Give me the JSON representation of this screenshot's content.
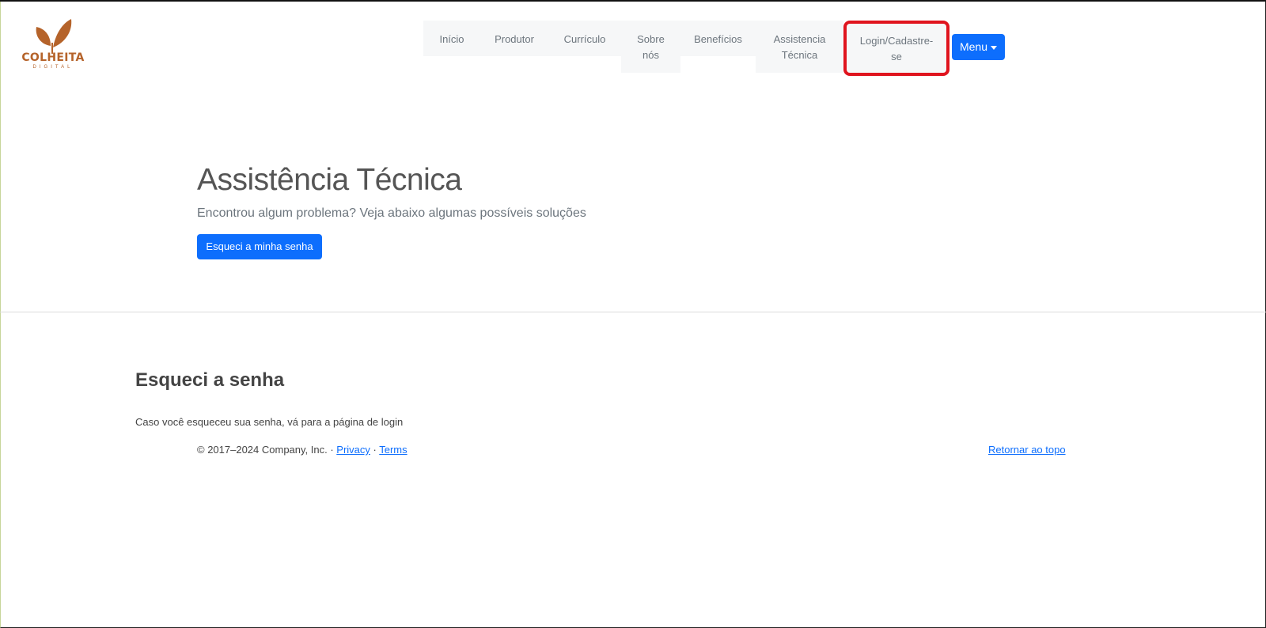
{
  "logo": {
    "word": "COLHEITA",
    "sub": "DIGITAL",
    "leaf_color": "#b5632a"
  },
  "nav": {
    "items": [
      {
        "line1": "Início",
        "line2": ""
      },
      {
        "line1": "Produtor",
        "line2": ""
      },
      {
        "line1": "Currículo",
        "line2": ""
      },
      {
        "line1": "Sobre",
        "line2": "nós"
      },
      {
        "line1": "Benefícios",
        "line2": ""
      },
      {
        "line1": "Assistencia",
        "line2": "Técnica"
      },
      {
        "line1": "Login/Cadastre-",
        "line2": "se"
      }
    ],
    "menu_label": "Menu"
  },
  "hero": {
    "title": "Assistência Técnica",
    "subtitle": "Encontrou algum problema? Veja abaixo algumas possíveis soluções",
    "button_label": "Esqueci a minha senha"
  },
  "section": {
    "title": "Esqueci a senha",
    "text": "Caso você esqueceu sua senha, vá para a página de login"
  },
  "footer": {
    "copyright": "© 2017–2024 Company, Inc. · ",
    "privacy": "Privacy",
    "separator": " · ",
    "terms": "Terms",
    "back_to_top": "Retornar ao topo"
  },
  "colors": {
    "primary": "#0d6efd",
    "highlight": "#e0141e"
  }
}
